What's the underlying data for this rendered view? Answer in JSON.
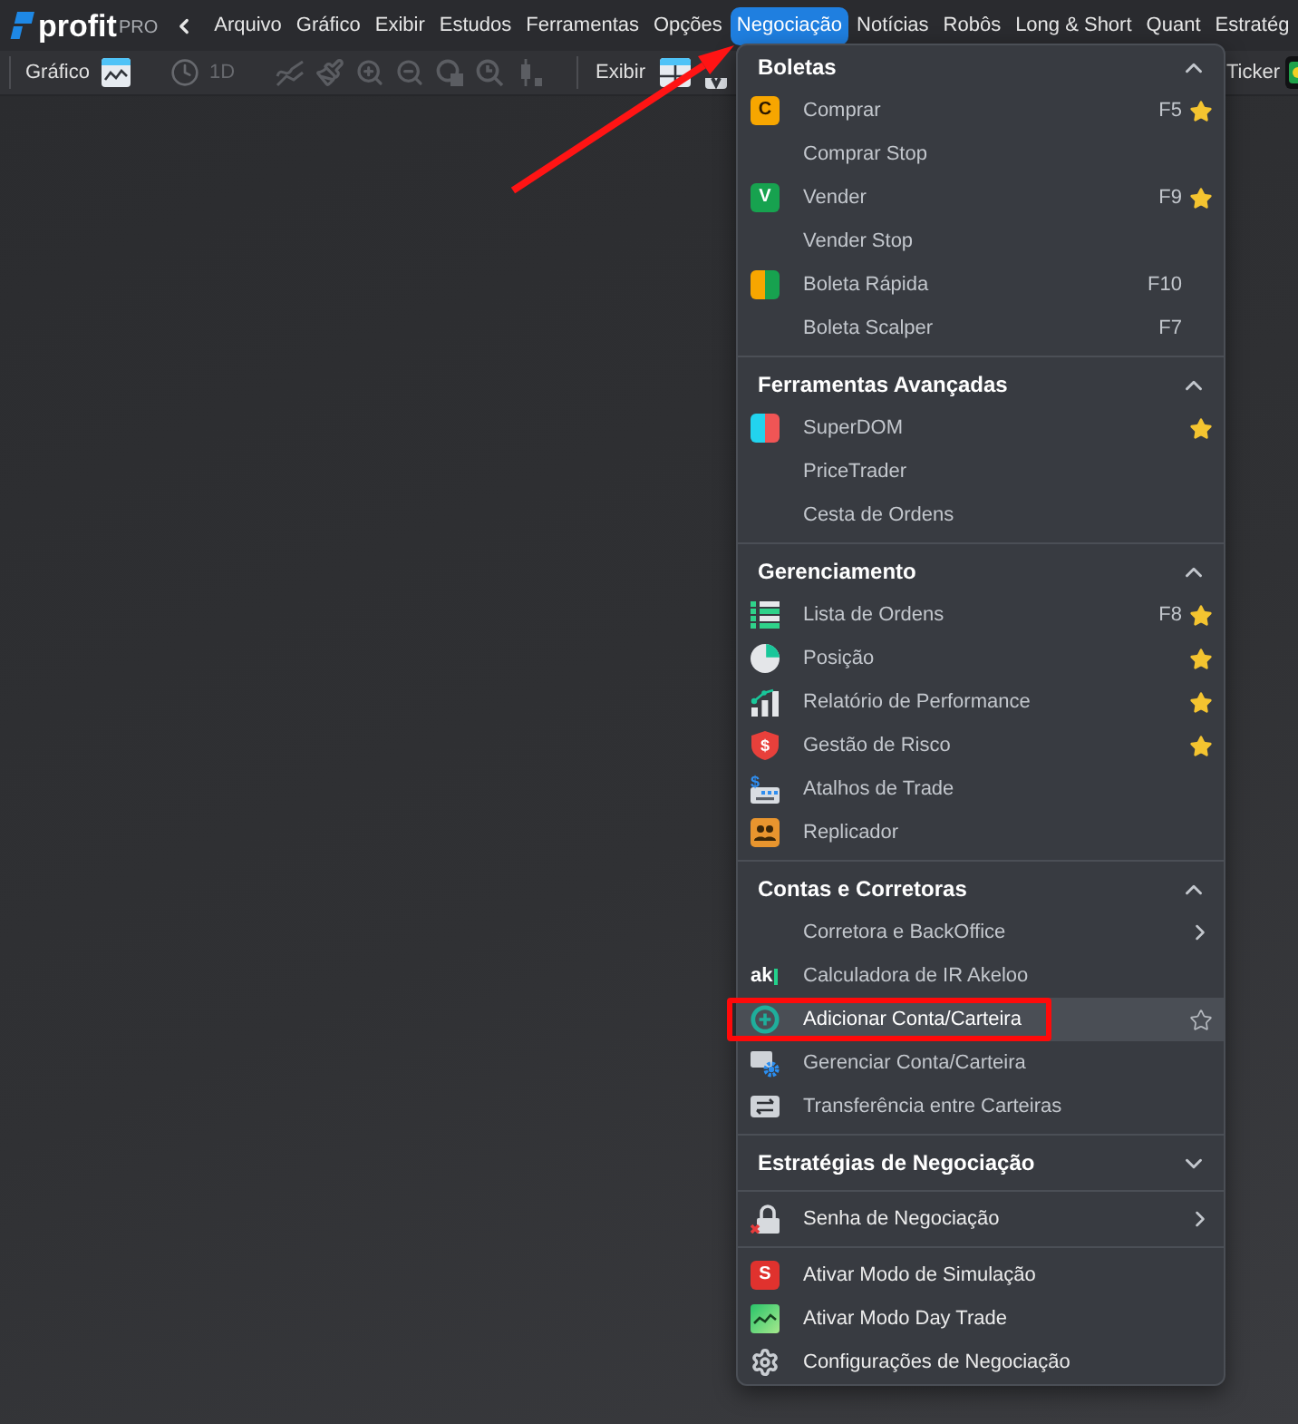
{
  "menubar": {
    "logo": {
      "name": "profit",
      "edition": "PRO"
    },
    "menus": [
      {
        "label": "Arquivo",
        "selected": false
      },
      {
        "label": "Gráfico",
        "selected": false
      },
      {
        "label": "Exibir",
        "selected": false
      },
      {
        "label": "Estudos",
        "selected": false
      },
      {
        "label": "Ferramentas",
        "selected": false
      },
      {
        "label": "Opções",
        "selected": false
      },
      {
        "label": "Negociação",
        "selected": true
      },
      {
        "label": "Notícias",
        "selected": false
      },
      {
        "label": "Robôs",
        "selected": false
      },
      {
        "label": "Long & Short",
        "selected": false
      },
      {
        "label": "Quant",
        "selected": false
      },
      {
        "label": "Estratég",
        "selected": false
      }
    ]
  },
  "toolbar": {
    "chart_label": "Gráfico",
    "period": {
      "label": "1D",
      "disabled": true
    },
    "tools_disabled": true,
    "view_label": "Exibir",
    "ticker_label": "Ticker"
  },
  "dropdown": {
    "sections": [
      {
        "title": "Boletas",
        "expanded": true,
        "items": [
          {
            "label": "Comprar",
            "icon_text": "C",
            "shortcut": "F5",
            "favorite": true,
            "hovered": false,
            "submenu": false
          },
          {
            "label": "Comprar Stop",
            "favorite": false,
            "hovered": false,
            "submenu": false
          },
          {
            "label": "Vender",
            "icon_text": "V",
            "shortcut": "F9",
            "favorite": true,
            "hovered": false,
            "submenu": false
          },
          {
            "label": "Vender Stop",
            "favorite": false,
            "hovered": false,
            "submenu": false
          },
          {
            "label": "Boleta Rápida",
            "shortcut": "F10",
            "favorite": false,
            "hovered": false,
            "submenu": false
          },
          {
            "label": "Boleta Scalper",
            "shortcut": "F7",
            "favorite": false,
            "hovered": false,
            "submenu": false
          }
        ]
      },
      {
        "title": "Ferramentas Avançadas",
        "expanded": true,
        "items": [
          {
            "label": "SuperDOM",
            "favorite": true,
            "hovered": false,
            "submenu": false
          },
          {
            "label": "PriceTrader",
            "favorite": false,
            "hovered": false,
            "submenu": false
          },
          {
            "label": "Cesta de Ordens",
            "favorite": false,
            "hovered": false,
            "submenu": false
          }
        ]
      },
      {
        "title": "Gerenciamento",
        "expanded": true,
        "items": [
          {
            "label": "Lista de Ordens",
            "shortcut": "F8",
            "favorite": true,
            "hovered": false,
            "submenu": false
          },
          {
            "label": "Posição",
            "favorite": true,
            "hovered": false,
            "submenu": false
          },
          {
            "label": "Relatório de Performance",
            "favorite": true,
            "hovered": false,
            "submenu": false
          },
          {
            "label": "Gestão de Risco",
            "icon_text": "$",
            "favorite": true,
            "hovered": false,
            "submenu": false
          },
          {
            "label": "Atalhos de Trade",
            "icon_text": "$",
            "favorite": false,
            "hovered": false,
            "submenu": false
          },
          {
            "label": "Replicador",
            "favorite": false,
            "hovered": false,
            "submenu": false
          }
        ]
      },
      {
        "title": "Contas e Corretoras",
        "expanded": true,
        "items": [
          {
            "label": "Corretora e BackOffice",
            "favorite": false,
            "hovered": false,
            "submenu": true
          },
          {
            "label": "Calculadora de IR Akeloo",
            "icon_text": "ak",
            "favorite": false,
            "hovered": false,
            "submenu": false
          },
          {
            "label": "Adicionar Conta/Carteira",
            "favorite": false,
            "hovered": true,
            "submenu": false
          },
          {
            "label": "Gerenciar Conta/Carteira",
            "favorite": false,
            "hovered": false,
            "submenu": false
          },
          {
            "label": "Transferência entre Carteiras",
            "favorite": false,
            "hovered": false,
            "submenu": false
          }
        ]
      },
      {
        "title": "Estratégias de Negociação",
        "expanded": false
      },
      {
        "items": [
          {
            "label": "Senha de Negociação",
            "favorite": false,
            "hovered": false,
            "submenu": true
          }
        ]
      },
      {
        "items": [
          {
            "label": "Ativar Modo de Simulação",
            "icon_text": "S",
            "favorite": false,
            "hovered": false,
            "submenu": false
          },
          {
            "label": "Ativar Modo Day Trade",
            "favorite": false,
            "hovered": false,
            "submenu": false
          },
          {
            "label": "Configurações de Negociação",
            "favorite": false,
            "hovered": false,
            "submenu": false
          }
        ]
      }
    ]
  }
}
